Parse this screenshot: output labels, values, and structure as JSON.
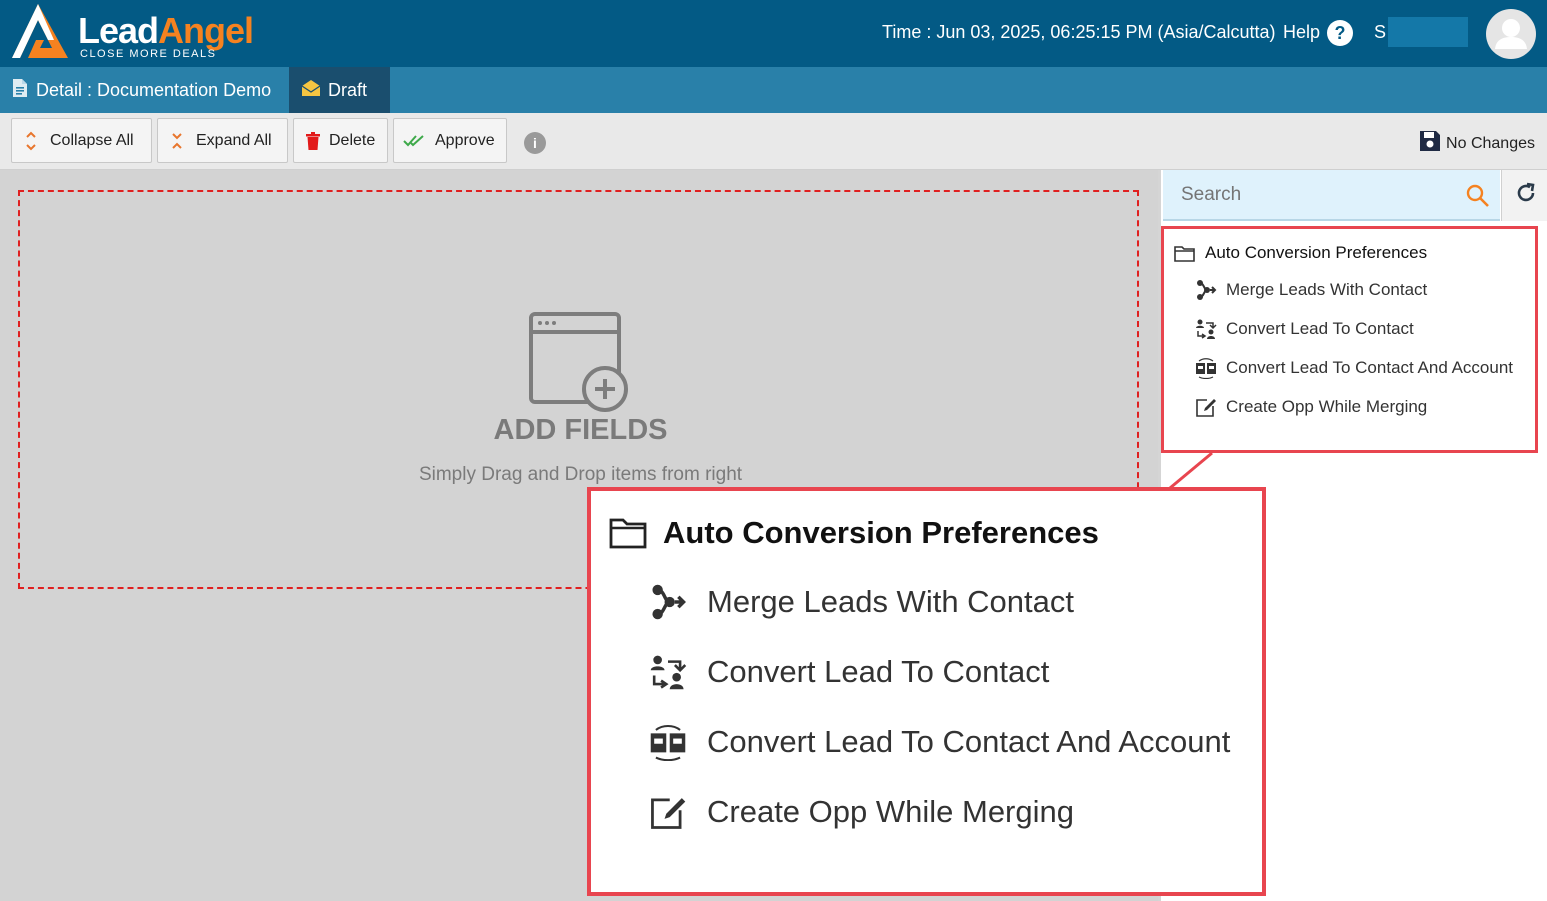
{
  "header": {
    "logo_lead": "Lead",
    "logo_angel": "Angel",
    "logo_tagline": "CLOSE MORE DEALS",
    "time_label": "Time : Jun 03, 2025, 06:25:15 PM (Asia/Calcutta)",
    "help_label": "Help",
    "user_name": "S                u"
  },
  "tabs": {
    "detail_label": "Detail : Documentation Demo",
    "draft_label": "Draft"
  },
  "toolbar": {
    "collapse_label": "Collapse All",
    "expand_label": "Expand All",
    "delete_label": "Delete",
    "approve_label": "Approve",
    "status_label": "No Changes"
  },
  "canvas": {
    "title": "ADD FIELDS",
    "subtitle": "Simply Drag and Drop items from right"
  },
  "search": {
    "placeholder": "Search"
  },
  "tree": {
    "folder": "Auto Conversion Preferences",
    "items": [
      {
        "label": "Merge Leads With Contact",
        "icon": "merge-icon"
      },
      {
        "label": "Convert Lead To Contact",
        "icon": "convert-contact-icon"
      },
      {
        "label": "Convert Lead To Contact And Account",
        "icon": "convert-account-icon"
      },
      {
        "label": "Create Opp While Merging",
        "icon": "edit-icon"
      }
    ]
  },
  "colors": {
    "header_bg": "#035a85",
    "tabbar_bg": "#2980a9",
    "brand_orange": "#f58220",
    "highlight_red": "#e8454f"
  }
}
